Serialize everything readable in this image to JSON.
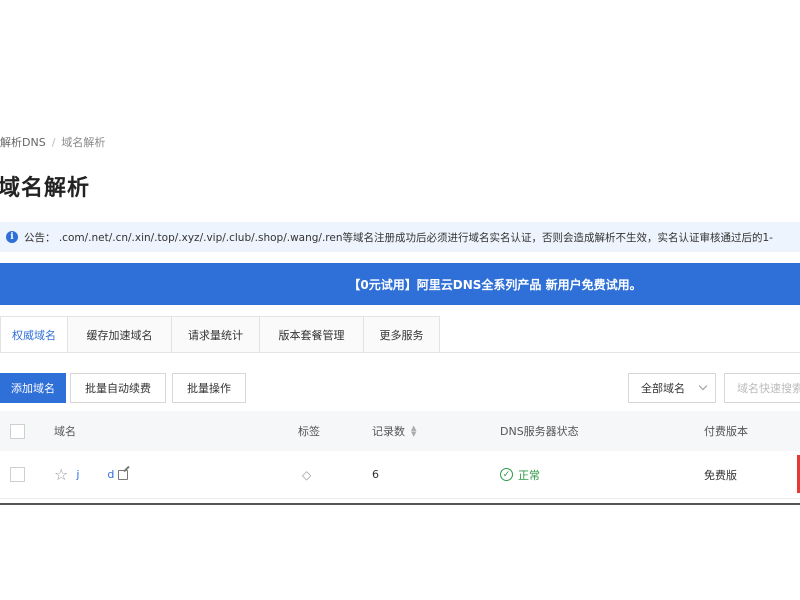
{
  "breadcrumb": {
    "parent": "解析DNS",
    "separator": "/",
    "current": "域名解析"
  },
  "page_title": "域名解析",
  "notice": {
    "icon": "info-icon",
    "text": "公告： .com/.net/.cn/.xin/.top/.xyz/.vip/.club/.shop/.wang/.ren等域名注册成功后必须进行域名实名认证，否则会造成解析不生效，实名认证审核通过后的1-"
  },
  "promo": {
    "text": "【0元试用】阿里云DNS全系列产品 新用户免费试用。"
  },
  "tabs": [
    {
      "label": "权威域名",
      "active": true
    },
    {
      "label": "缓存加速域名",
      "active": false
    },
    {
      "label": "请求量统计",
      "active": false
    },
    {
      "label": "版本套餐管理",
      "active": false
    },
    {
      "label": "更多服务",
      "active": false
    }
  ],
  "toolbar": {
    "add_label": "添加域名",
    "renew_label": "批量自动续费",
    "batch_label": "批量操作",
    "filter_value": "全部域名",
    "search_placeholder": "域名快速搜索"
  },
  "table": {
    "headers": {
      "domain": "域名",
      "tag": "标签",
      "records": "记录数",
      "dns_status": "DNS服务器状态",
      "version": "付费版本"
    },
    "rows": [
      {
        "domain_start": "j",
        "domain_end": "d",
        "records": "6",
        "status": "正常",
        "version": "免费版"
      }
    ]
  },
  "colors": {
    "accent": "#2f6fd8",
    "status_ok": "#2f9b45",
    "notice_bg": "#eef4fd"
  }
}
